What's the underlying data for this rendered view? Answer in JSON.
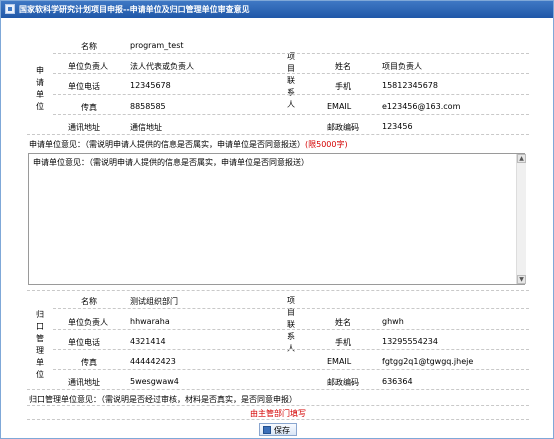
{
  "window": {
    "title": "国家软科学研究计划项目申报--申请单位及归口管理单位审查意见"
  },
  "applicant": {
    "section_label": "申请单位",
    "name_label": "名称",
    "name_value": "program_test",
    "head_label": "单位负责人",
    "head_value": "法人代表或负责人",
    "phone_label": "单位电话",
    "phone_value": "12345678",
    "fax_label": "传真",
    "fax_value": "8858585",
    "address_label": "通讯地址",
    "address_value": "通信地址",
    "contact_section_label": "项目联系人",
    "contact_name_label": "姓名",
    "contact_name_value": "项目负责人",
    "mobile_label": "手机",
    "mobile_value": "15812345678",
    "email_label": "EMAIL",
    "email_value": "e123456@163.com",
    "postcode_label": "邮政编码",
    "postcode_value": "123456",
    "opinion_label": "申请单位意见：（需说明申请人提供的信息是否属实，申请单位是否同意报送）",
    "opinion_limit": "(限5000字)",
    "opinion_text": "申请单位意见：（需说明申请人提供的信息是否属实，申请单位是否同意报送）"
  },
  "authority": {
    "section_label": "归口管理单位",
    "name_label": "名称",
    "name_value": "测试组织部门",
    "head_label": "单位负责人",
    "head_value": "hhwaraha",
    "phone_label": "单位电话",
    "phone_value": "4321414",
    "fax_label": "传真",
    "fax_value": "444442423",
    "address_label": "通讯地址",
    "address_value": "5wesgwaw4",
    "contact_section_label": "项目联系人",
    "contact_name_label": "姓名",
    "contact_name_value": "ghwh",
    "mobile_label": "手机",
    "mobile_value": "13295554234",
    "email_label": "EMAIL",
    "email_value": "fgtgg2q1@tgwgq.jheje",
    "postcode_label": "邮政编码",
    "postcode_value": "636364",
    "opinion_label": "归口管理单位意见：（需说明是否经过审核，材料是否真实，是否同意申报）",
    "opinion_note": "由主管部门填写"
  },
  "actions": {
    "save_label": "保存"
  }
}
